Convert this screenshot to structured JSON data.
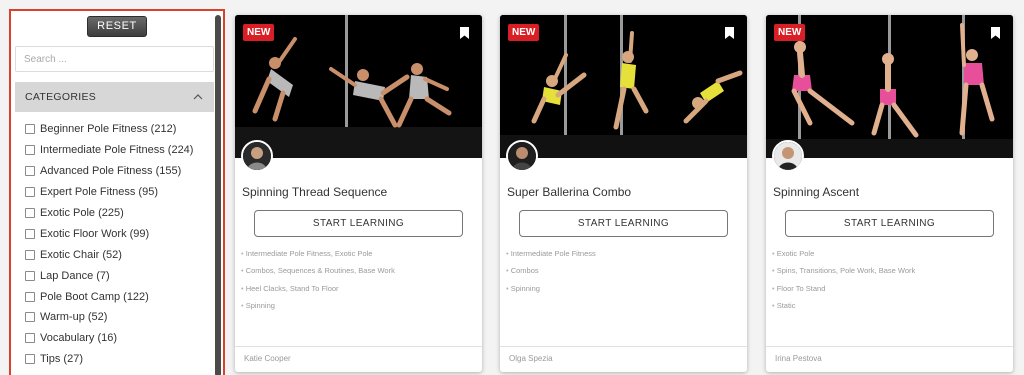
{
  "sidebar": {
    "reset_label": "RESET",
    "search_placeholder": "Search ...",
    "categories_title": "CATEGORIES",
    "items": [
      {
        "label": "Beginner Pole Fitness (212)"
      },
      {
        "label": "Intermediate Pole Fitness (224)"
      },
      {
        "label": "Advanced Pole Fitness (155)"
      },
      {
        "label": "Expert Pole Fitness (95)"
      },
      {
        "label": "Exotic Pole (225)"
      },
      {
        "label": "Exotic Floor Work (99)"
      },
      {
        "label": "Exotic Chair (52)"
      },
      {
        "label": "Lap Dance (7)"
      },
      {
        "label": "Pole Boot Camp (122)"
      },
      {
        "label": "Warm-up (52)"
      },
      {
        "label": "Vocabulary (16)"
      },
      {
        "label": "Tips (27)"
      }
    ]
  },
  "cards": [
    {
      "badge": "NEW",
      "title": "Spinning Thread Sequence",
      "button": "START LEARNING",
      "tags": [
        "Intermediate Pole Fitness, Exotic Pole",
        "Combos, Sequences & Routines, Base Work",
        "Heel Clacks, Stand To Floor",
        "Spinning"
      ],
      "instructor": "Katie Cooper",
      "costume_color": "#b9b9b9"
    },
    {
      "badge": "NEW",
      "title": "Super Ballerina Combo",
      "button": "START LEARNING",
      "tags": [
        "Intermediate Pole Fitness",
        "Combos",
        "Spinning"
      ],
      "instructor": "Olga Spezia",
      "costume_color": "#e6e03a"
    },
    {
      "badge": "NEW",
      "title": "Spinning Ascent",
      "button": "START LEARNING",
      "tags": [
        "Exotic Pole",
        "Spins, Transitions, Pole Work, Base Work",
        "Floor To Stand",
        "Static"
      ],
      "instructor": "Irina Pestova",
      "costume_color": "#e84f9b"
    }
  ],
  "colors": {
    "accent_border": "#d9412b",
    "badge": "#d91f26"
  },
  "icons": {
    "bookmark": "bookmark-icon",
    "chevron": "chevron-up-icon",
    "checkbox": "checkbox-icon"
  }
}
